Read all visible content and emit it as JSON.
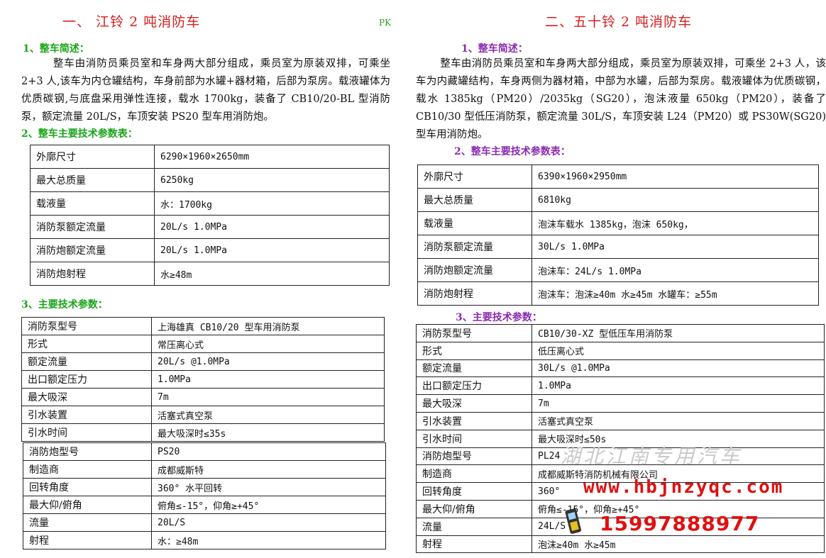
{
  "left": {
    "title": "一、 江铃 2 吨消防车",
    "mark": "PK",
    "overview_heading": "1、整车简述：",
    "overview_text": "整车由消防员乘员室和车身两大部分组成，乘员室为原装双排，可乘坐 2+3 人,该车为内仓罐结构，车身前部为水罐+器材箱，后部为泵房。载液罐体为优质碳钢,与底盘采用弹性连接，载水 1700kg，装备了 CB10/20-BL 型消防泵，额定流量 20L/S，车顶安装 PS20 型车用消防炮。",
    "params_heading": "2、整车主要技术参数表：",
    "params": [
      {
        "k": "外廓尺寸",
        "v": "6290×1960×2650mm"
      },
      {
        "k": "最大总质量",
        "v": "6250kg"
      },
      {
        "k": "载液量",
        "v": "水：1700kg"
      },
      {
        "k": "消防泵额定流量",
        "v": "20L/s  1.0MPa"
      },
      {
        "k": "消防炮额定流量",
        "v": "20L/s  1.0MPa"
      },
      {
        "k": "消防炮射程",
        "v": "水≥48m"
      }
    ],
    "tech_heading": "3、主要技术参数：",
    "pump": [
      {
        "k": "消防泵型号",
        "v": "上海雄真 CB10/20 型车用消防泵"
      },
      {
        "k": "形式",
        "v": "常压离心式"
      },
      {
        "k": "额定流量",
        "v": "20L/s @1.0MPa"
      },
      {
        "k": "出口额定压力",
        "v": "1.0MPa"
      },
      {
        "k": "最大吸深",
        "v": "7m"
      },
      {
        "k": "引水装置",
        "v": "活塞式真空泵"
      },
      {
        "k": "引水时间",
        "v": "最大吸深时≤35s"
      }
    ],
    "cannon": [
      {
        "k": "消防炮型号",
        "v": "PS20"
      },
      {
        "k": "制造商",
        "v": "成都威斯特"
      },
      {
        "k": "回转角度",
        "v": "360° 水平回转"
      },
      {
        "k": "最大仰/俯角",
        "v": "俯角≤-15°，仰角≥+45°"
      },
      {
        "k": "流量",
        "v": "20L/S"
      },
      {
        "k": "射程",
        "v": "水：≥48m"
      }
    ]
  },
  "right": {
    "title": "二、五十铃 2 吨消防车",
    "overview_heading": "1、整车简述：",
    "overview_text": "整车由消防员乘员室和车身两大部分组成，乘员室为原装双排，可乘坐 2+3 人，该车为内藏罐结构，车身两侧为器材箱，中部为水罐，后部为泵房。载液罐体为优质碳钢，载水 1385kg（PM20）/2035kg（SG20），泡沫液量 650kg（PM20），装备了 CB10/30 型低压消防泵，额定流量 30L/S，车顶安装 L24（PM20）或 PS30W(SG20) 型车用消防炮。",
    "params_heading": "2、整车主要技术参数表：",
    "params": [
      {
        "k": "外廓尺寸",
        "v": "6390×1960×2950mm"
      },
      {
        "k": "最大总质量",
        "v": "6810kg"
      },
      {
        "k": "载液量",
        "v": "泡沫车载水 1385kg，泡沫 650kg，"
      },
      {
        "k": "消防泵额定流量",
        "v": "30L/s  1.0MPa"
      },
      {
        "k": "消防炮额定流量",
        "v": "泡沫车：24L/s 1.0MPa"
      },
      {
        "k": "消防炮射程",
        "v": "泡沫车：泡沫≥40m  水≥45m  水罐车：≥55m"
      }
    ],
    "tech_heading": "3、主要技术参数：",
    "specs": [
      {
        "k": "消防泵型号",
        "v": "CB10/30-XZ 型低压车用消防泵"
      },
      {
        "k": "形式",
        "v": "低压离心式"
      },
      {
        "k": "额定流量",
        "v": "30L/s @1.0MPa"
      },
      {
        "k": "出口额定压力",
        "v": "1.0MPa"
      },
      {
        "k": "最大吸深",
        "v": "7m"
      },
      {
        "k": "引水装置",
        "v": "活塞式真空泵"
      },
      {
        "k": "引水时间",
        "v": "最大吸深时≤50s"
      },
      {
        "k": "消防炮型号",
        "v": "PL24"
      },
      {
        "k": "制造商",
        "v": "成都威斯特消防机械有限公司"
      },
      {
        "k": "回转角度",
        "v": "360°"
      },
      {
        "k": "最大仰/俯角",
        "v": "俯角≤-15°，仰角≥+45°"
      },
      {
        "k": "流量",
        "v": "24L/S"
      },
      {
        "k": "射程",
        "v": "泡沫≥40m  水≥45m"
      }
    ]
  },
  "watermark": {
    "company": "湖北江南专用汽车",
    "url": "www.hbjnzyqc.com",
    "phone": "15997888977"
  }
}
